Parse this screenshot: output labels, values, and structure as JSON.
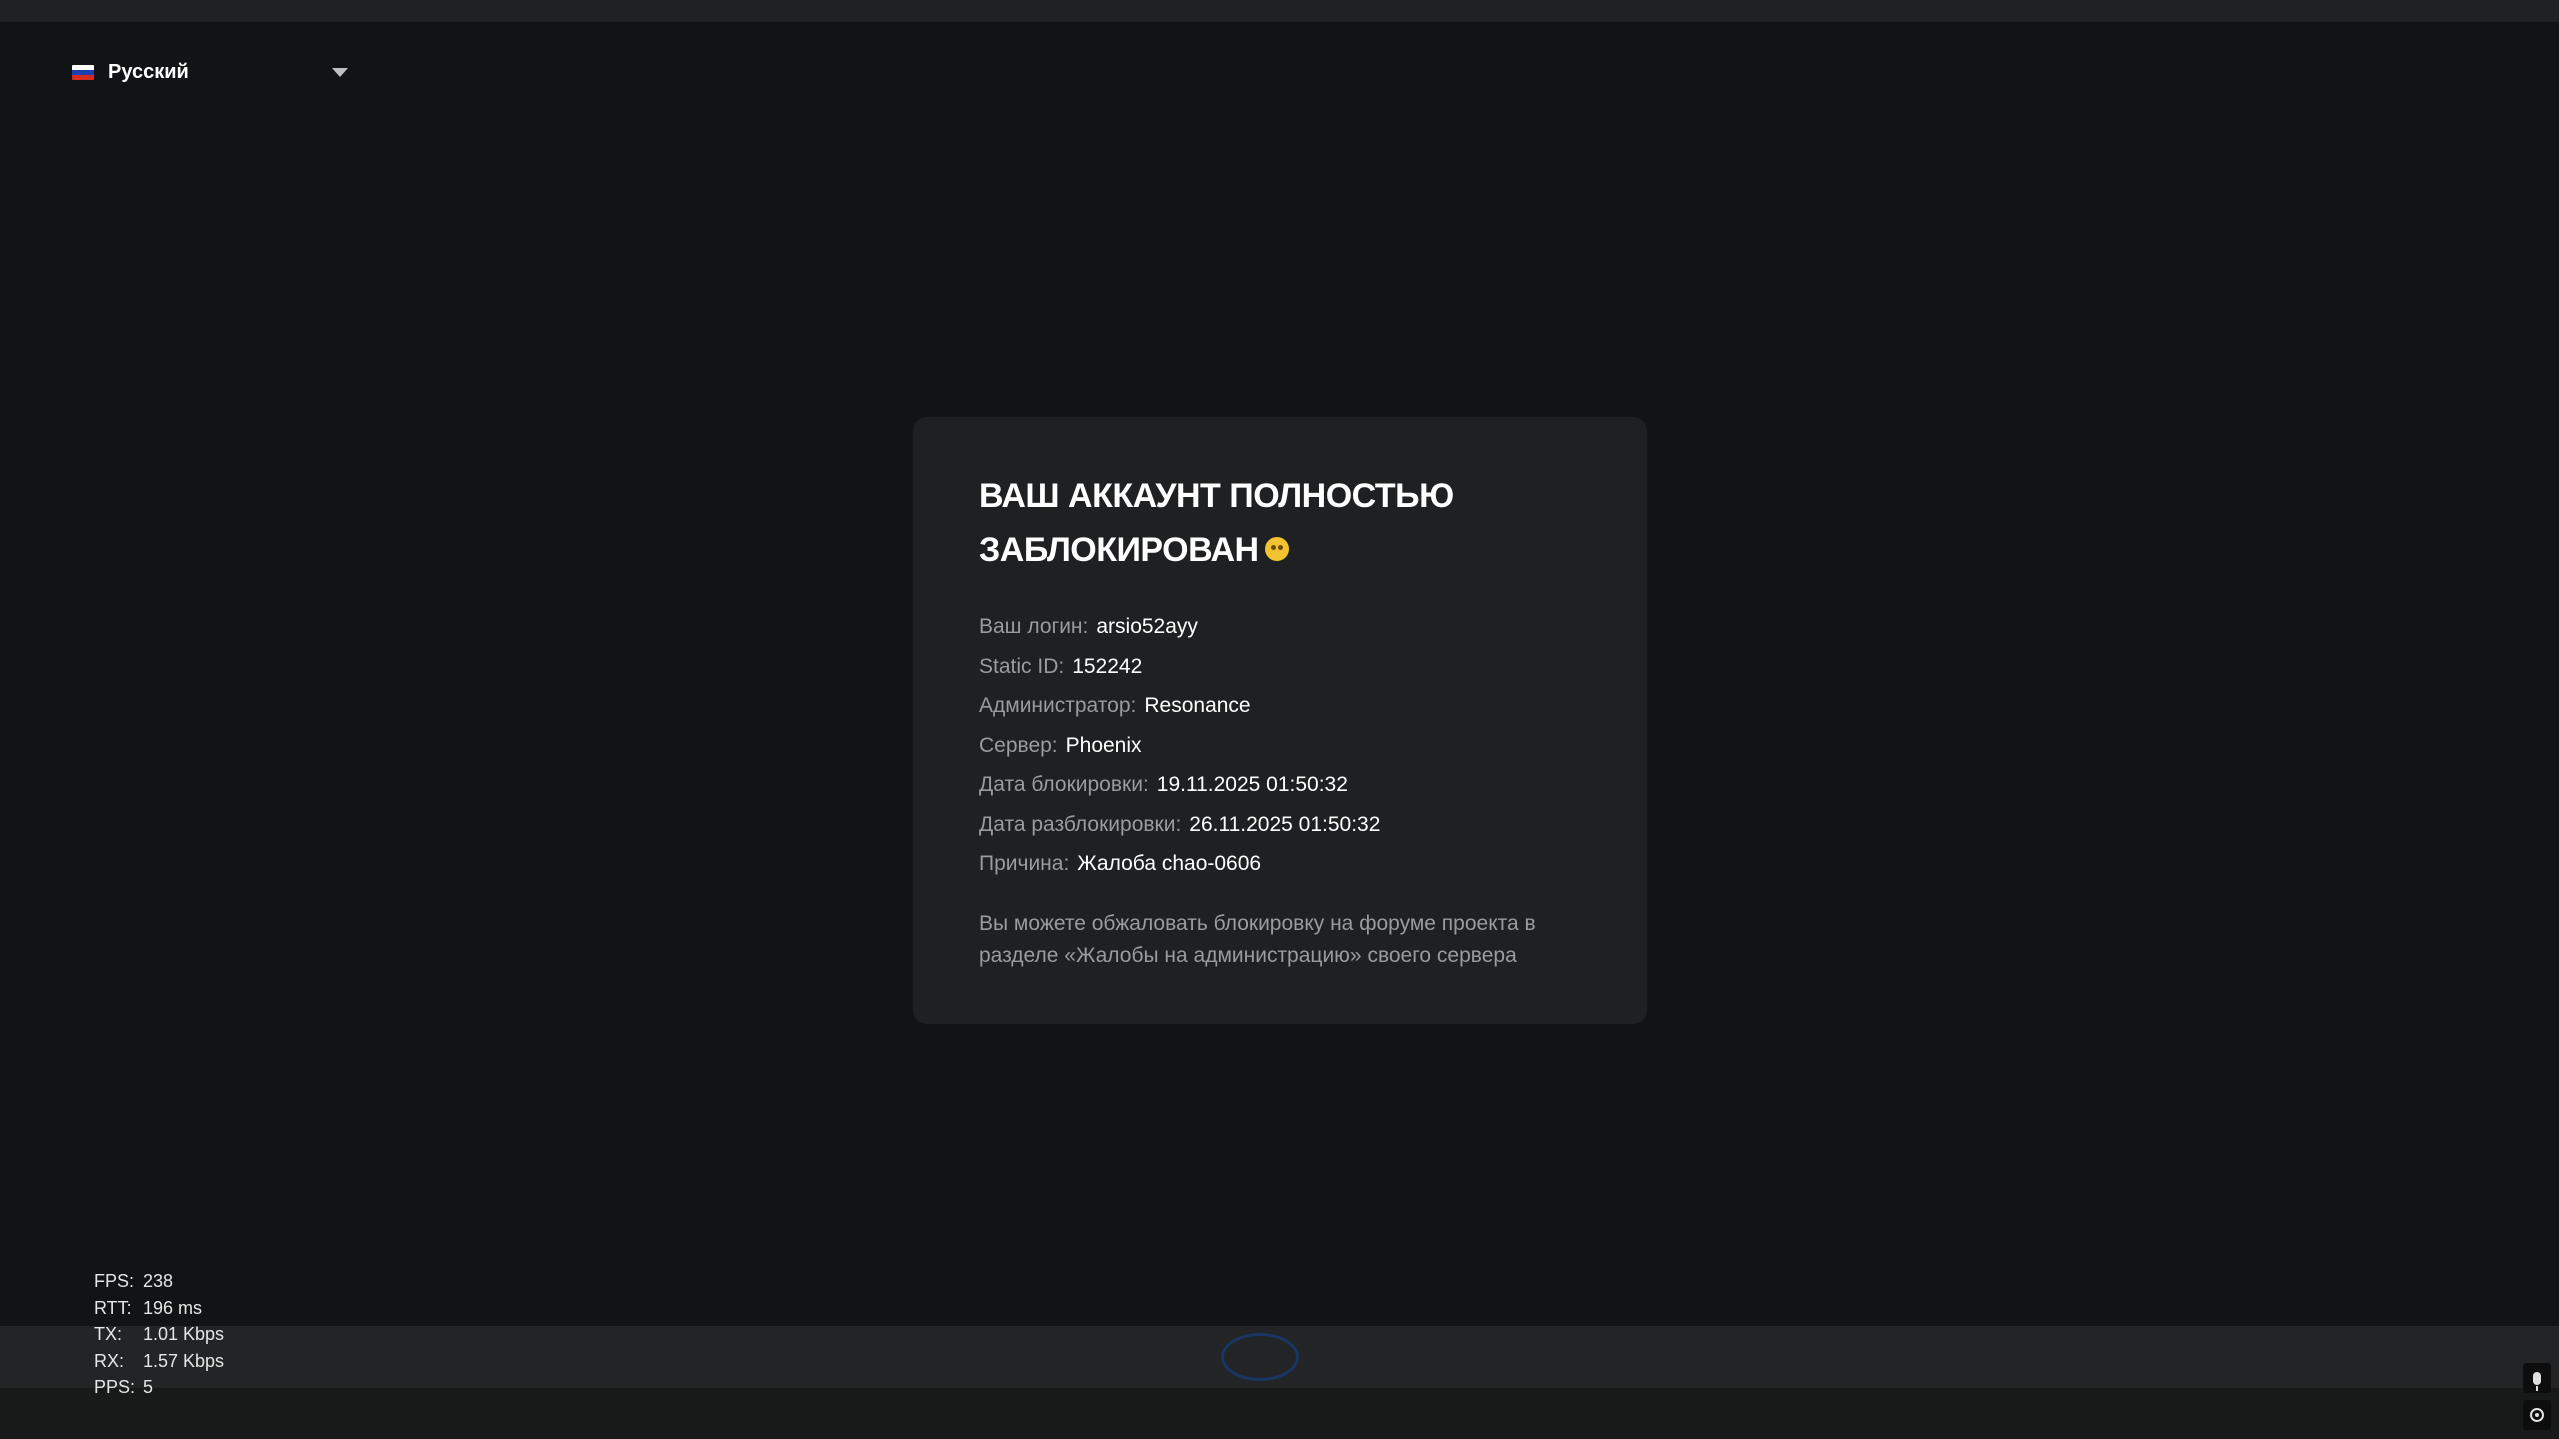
{
  "language": {
    "label": "Русский",
    "flag_colors": [
      "#ffffff",
      "#1c3fb0",
      "#d52b1e"
    ]
  },
  "ban": {
    "title_line1": "ВАШ АККАУНТ ПОЛНОСТЬЮ",
    "title_line2": "ЗАБЛОКИРОВАН",
    "title_emoji": "dizzy-face-emoji",
    "rows": [
      {
        "label": "Ваш логин:",
        "value": "arsio52ayy"
      },
      {
        "label": "Static ID:",
        "value": "152242"
      },
      {
        "label": "Администратор:",
        "value": "Resonance"
      },
      {
        "label": "Сервер:",
        "value": "Phoenix"
      },
      {
        "label": "Дата блокировки:",
        "value": "19.11.2025 01:50:32"
      },
      {
        "label": "Дата разблокировки:",
        "value": "26.11.2025 01:50:32"
      },
      {
        "label": "Причина:",
        "value": "Жалоба chao-0606"
      }
    ],
    "note": "Вы можете обжаловать блокировку на форуме проекта в разделе «Жалобы на администрацию» своего сервера"
  },
  "stats": [
    {
      "key": "FPS:",
      "value": "238"
    },
    {
      "key": "RTT:",
      "value": "196 ms"
    },
    {
      "key": "TX:",
      "value": "1.01 Kbps"
    },
    {
      "key": "RX:",
      "value": "1.57 Kbps"
    },
    {
      "key": "PPS:",
      "value": "5"
    }
  ],
  "icons": {
    "mic": "microphone-icon",
    "target": "target-icon",
    "chevron": "chevron-down-icon"
  }
}
